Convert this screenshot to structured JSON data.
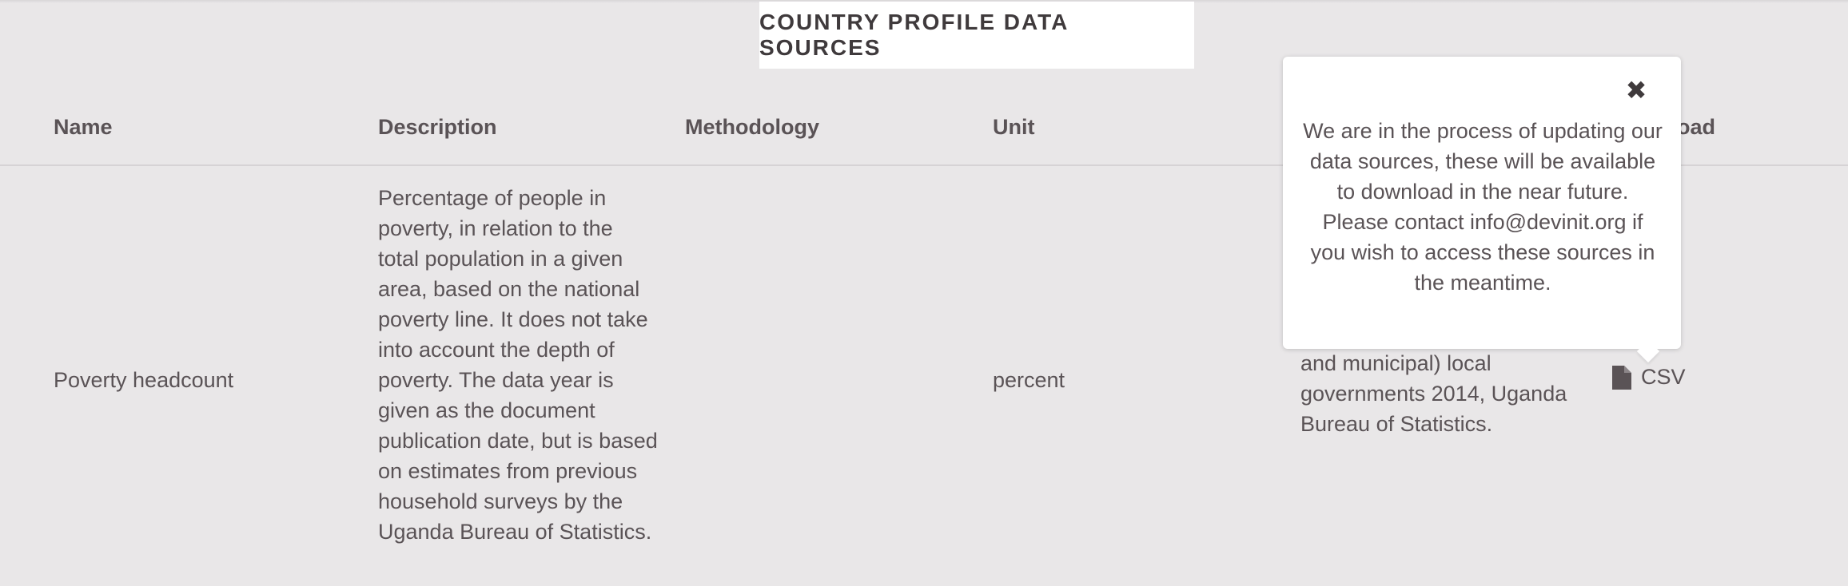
{
  "header": {
    "title": "COUNTRY PROFILE DATA SOURCES"
  },
  "table": {
    "columns": {
      "name": "Name",
      "description": "Description",
      "methodology": "Methodology",
      "unit": "Unit",
      "download_partial": "oad"
    },
    "row": {
      "name": "Poverty headcount",
      "description": "Percentage of people in poverty, in relation to the total population in a given area, based on the national poverty line. It does not take into account the depth of poverty. The data year is given as the document publication date, but is based on estimates from previous household surveys by the Uganda Bureau of Statistics.",
      "methodology": "",
      "unit": "percent",
      "source_visible": "and municipal) local governments 2014, Uganda Bureau of Statistics.",
      "download_label": "CSV",
      "download_icon": "file-icon"
    }
  },
  "popover": {
    "close_icon": "close-icon",
    "message": "We are in the process of updating our data sources, these will be available to download in the near future. Please contact info@devinit.org if you wish to access these sources in the meantime."
  }
}
